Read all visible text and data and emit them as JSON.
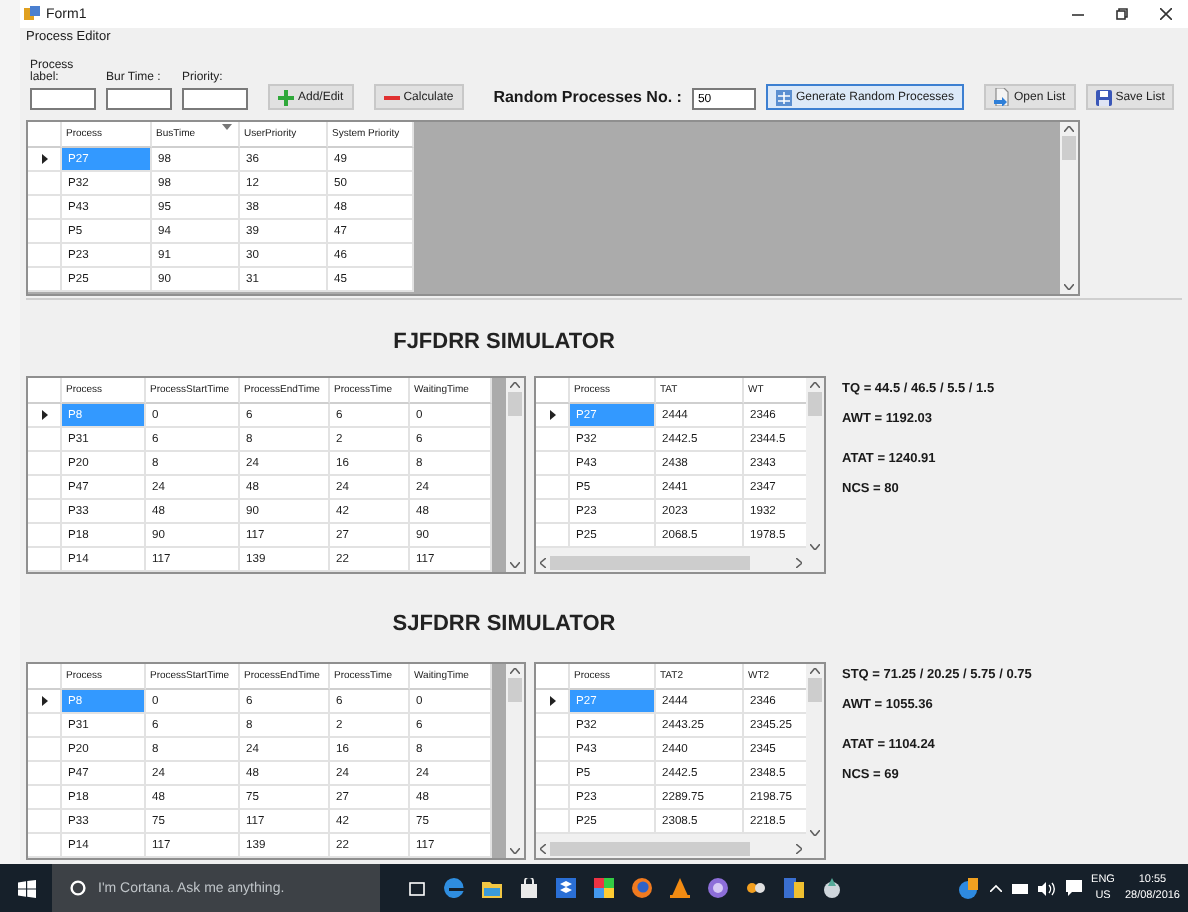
{
  "window": {
    "title": "Form1"
  },
  "process_editor": {
    "title": "Process Editor",
    "fields": [
      {
        "label": "Process label:"
      },
      {
        "label": "Bur Time :"
      },
      {
        "label": "Priority:"
      }
    ],
    "actions": [
      {
        "kind": "add",
        "label": "Add/Edit"
      },
      {
        "kind": "calculate",
        "label": "Calculate"
      }
    ],
    "random_label": "Random Processes No. :",
    "random_value": "50",
    "generate": {
      "kind": "generate",
      "label": "Generate Random Processes"
    },
    "list_buttons": [
      {
        "kind": "open",
        "label": "Open List"
      },
      {
        "kind": "save",
        "label": "Save List"
      }
    ],
    "grid": {
      "columns": [
        {
          "label": "Process",
          "sorted": false
        },
        {
          "label": "BusTime",
          "sorted": true
        },
        {
          "label": "UserPriority",
          "sorted": false
        },
        {
          "label": "System Priority",
          "sorted": false
        }
      ],
      "rows": [
        {
          "selected": true,
          "cells": [
            "P27",
            "98",
            "36",
            "49"
          ]
        },
        {
          "selected": false,
          "cells": [
            "P32",
            "98",
            "12",
            "50"
          ]
        },
        {
          "selected": false,
          "cells": [
            "P43",
            "95",
            "38",
            "48"
          ]
        },
        {
          "selected": false,
          "cells": [
            "P5",
            "94",
            "39",
            "47"
          ]
        },
        {
          "selected": false,
          "cells": [
            "P23",
            "91",
            "30",
            "46"
          ]
        },
        {
          "selected": false,
          "cells": [
            "P25",
            "90",
            "31",
            "45"
          ]
        }
      ]
    }
  },
  "simulators": [
    {
      "title": "FJFDRR SIMULATOR",
      "process_grid": {
        "columns": [
          {
            "label": "Process",
            "sorted": false
          },
          {
            "label": "ProcessStartTime",
            "sorted": false
          },
          {
            "label": "ProcessEndTime",
            "sorted": false
          },
          {
            "label": "ProcessTime",
            "sorted": false
          },
          {
            "label": "WaitingTime",
            "sorted": false
          }
        ],
        "rows": [
          {
            "selected": true,
            "cells": [
              "P8",
              "0",
              "6",
              "6",
              "0"
            ]
          },
          {
            "selected": false,
            "cells": [
              "P31",
              "6",
              "8",
              "2",
              "6"
            ]
          },
          {
            "selected": false,
            "cells": [
              "P20",
              "8",
              "24",
              "16",
              "8"
            ]
          },
          {
            "selected": false,
            "cells": [
              "P47",
              "24",
              "48",
              "24",
              "24"
            ]
          },
          {
            "selected": false,
            "cells": [
              "P33",
              "48",
              "90",
              "42",
              "48"
            ]
          },
          {
            "selected": false,
            "cells": [
              "P18",
              "90",
              "117",
              "27",
              "90"
            ]
          },
          {
            "selected": false,
            "cells": [
              "P14",
              "117",
              "139",
              "22",
              "117"
            ]
          }
        ]
      },
      "result_grid": {
        "columns": [
          {
            "label": "Process",
            "sorted": false
          },
          {
            "label": "TAT",
            "sorted": false
          },
          {
            "label": "WT",
            "sorted": false
          }
        ],
        "rows": [
          {
            "selected": true,
            "cells": [
              "P27",
              "2444",
              "2346"
            ]
          },
          {
            "selected": false,
            "cells": [
              "P32",
              "2442.5",
              "2344.5"
            ]
          },
          {
            "selected": false,
            "cells": [
              "P43",
              "2438",
              "2343"
            ]
          },
          {
            "selected": false,
            "cells": [
              "P5",
              "2441",
              "2347"
            ]
          },
          {
            "selected": false,
            "cells": [
              "P23",
              "2023",
              "1932"
            ]
          },
          {
            "selected": false,
            "cells": [
              "P25",
              "2068.5",
              "1978.5"
            ]
          }
        ]
      },
      "stats": [
        "TQ = 44.5 / 46.5 / 5.5 / 1.5",
        "AWT = 1192.03",
        "ATAT = 1240.91",
        "NCS = 80"
      ]
    },
    {
      "title": "SJFDRR SIMULATOR",
      "process_grid": {
        "columns": [
          {
            "label": "Process",
            "sorted": false
          },
          {
            "label": "ProcessStartTime",
            "sorted": false
          },
          {
            "label": "ProcessEndTime",
            "sorted": false
          },
          {
            "label": "ProcessTime",
            "sorted": false
          },
          {
            "label": "WaitingTime",
            "sorted": false
          }
        ],
        "rows": [
          {
            "selected": true,
            "cells": [
              "P8",
              "0",
              "6",
              "6",
              "0"
            ]
          },
          {
            "selected": false,
            "cells": [
              "P31",
              "6",
              "8",
              "2",
              "6"
            ]
          },
          {
            "selected": false,
            "cells": [
              "P20",
              "8",
              "24",
              "16",
              "8"
            ]
          },
          {
            "selected": false,
            "cells": [
              "P47",
              "24",
              "48",
              "24",
              "24"
            ]
          },
          {
            "selected": false,
            "cells": [
              "P18",
              "48",
              "75",
              "27",
              "48"
            ]
          },
          {
            "selected": false,
            "cells": [
              "P33",
              "75",
              "117",
              "42",
              "75"
            ]
          },
          {
            "selected": false,
            "cells": [
              "P14",
              "117",
              "139",
              "22",
              "117"
            ]
          }
        ]
      },
      "result_grid": {
        "columns": [
          {
            "label": "Process",
            "sorted": false
          },
          {
            "label": "TAT2",
            "sorted": false
          },
          {
            "label": "WT2",
            "sorted": false
          }
        ],
        "rows": [
          {
            "selected": true,
            "cells": [
              "P27",
              "2444",
              "2346"
            ]
          },
          {
            "selected": false,
            "cells": [
              "P32",
              "2443.25",
              "2345.25"
            ]
          },
          {
            "selected": false,
            "cells": [
              "P43",
              "2440",
              "2345"
            ]
          },
          {
            "selected": false,
            "cells": [
              "P5",
              "2442.5",
              "2348.5"
            ]
          },
          {
            "selected": false,
            "cells": [
              "P23",
              "2289.75",
              "2198.75"
            ]
          },
          {
            "selected": false,
            "cells": [
              "P25",
              "2308.5",
              "2218.5"
            ]
          }
        ]
      },
      "stats": [
        "STQ = 71.25 / 20.25 / 5.75 / 0.75",
        "AWT = 1055.36",
        "ATAT = 1104.24",
        "NCS = 69"
      ]
    }
  ],
  "taskbar": {
    "search_placeholder": "I'm Cortana. Ask me anything.",
    "language": "ENG",
    "region": "US",
    "time": "10:55",
    "date": "28/08/2016"
  }
}
